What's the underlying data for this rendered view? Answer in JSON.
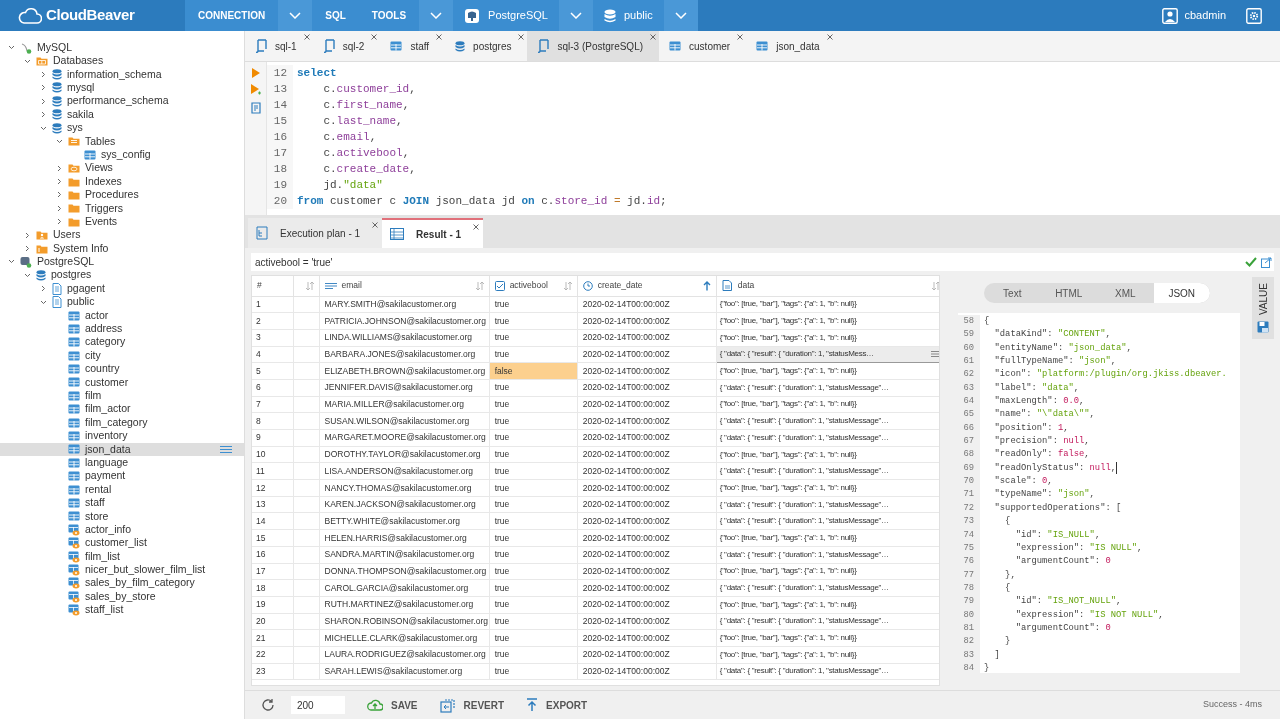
{
  "app": {
    "logo": "CloudBeaver",
    "menu": [
      {
        "kind": "text",
        "label": "CONNECTION"
      },
      {
        "kind": "dropdown"
      },
      {
        "kind": "text",
        "label": "SQL"
      },
      {
        "kind": "text",
        "label": "TOOLS"
      },
      {
        "kind": "dropdown"
      },
      {
        "kind": "connection",
        "label": "PostgreSQL"
      },
      {
        "kind": "dropdown"
      },
      {
        "kind": "schema",
        "label": "public"
      },
      {
        "kind": "dropdown"
      }
    ],
    "user": "cbadmin"
  },
  "tree": [
    {
      "label": "MySQL",
      "kind": "mysql",
      "expanded": true,
      "selected": false,
      "children": [
        {
          "label": "Databases",
          "kind": "db-folder",
          "expanded": true,
          "selected": false,
          "children": [
            {
              "label": "information_schema",
              "kind": "database",
              "expanded": false,
              "selected": false
            },
            {
              "label": "mysql",
              "kind": "database",
              "expanded": false,
              "selected": false
            },
            {
              "label": "performance_schema",
              "kind": "database",
              "expanded": false,
              "selected": false
            },
            {
              "label": "sakila",
              "kind": "database",
              "expanded": false,
              "selected": false
            },
            {
              "label": "sys",
              "kind": "database",
              "expanded": true,
              "selected": false,
              "children": [
                {
                  "label": "Tables",
                  "kind": "tables-folder",
                  "expanded": true,
                  "selected": false,
                  "children": [
                    {
                      "label": "sys_config",
                      "kind": "table",
                      "selected": false
                    }
                  ]
                },
                {
                  "label": "Views",
                  "kind": "views-folder",
                  "expanded": false,
                  "selected": false
                },
                {
                  "label": "Indexes",
                  "kind": "folder",
                  "expanded": false,
                  "selected": false
                },
                {
                  "label": "Procedures",
                  "kind": "folder",
                  "expanded": false,
                  "selected": false
                },
                {
                  "label": "Triggers",
                  "kind": "folder",
                  "expanded": false,
                  "selected": false
                },
                {
                  "label": "Events",
                  "kind": "folder",
                  "expanded": false,
                  "selected": false
                }
              ]
            }
          ]
        },
        {
          "label": "Users",
          "kind": "users-folder",
          "expanded": false,
          "selected": false
        },
        {
          "label": "System Info",
          "kind": "info-folder",
          "expanded": false,
          "selected": false
        }
      ]
    },
    {
      "label": "PostgreSQL",
      "kind": "postgres",
      "expanded": true,
      "selected": false,
      "children": [
        {
          "label": "postgres",
          "kind": "database",
          "expanded": true,
          "selected": false,
          "children": [
            {
              "label": "pgagent",
              "kind": "schema",
              "expanded": false,
              "selected": false
            },
            {
              "label": "public",
              "kind": "schema",
              "expanded": true,
              "selected": false,
              "children": [
                {
                  "label": "actor",
                  "kind": "table",
                  "selected": false
                },
                {
                  "label": "address",
                  "kind": "table",
                  "selected": false
                },
                {
                  "label": "category",
                  "kind": "table",
                  "selected": false
                },
                {
                  "label": "city",
                  "kind": "table",
                  "selected": false
                },
                {
                  "label": "country",
                  "kind": "table",
                  "selected": false
                },
                {
                  "label": "customer",
                  "kind": "table",
                  "selected": false
                },
                {
                  "label": "film",
                  "kind": "table",
                  "selected": false
                },
                {
                  "label": "film_actor",
                  "kind": "table",
                  "selected": false
                },
                {
                  "label": "film_category",
                  "kind": "table",
                  "selected": false
                },
                {
                  "label": "inventory",
                  "kind": "table",
                  "selected": false
                },
                {
                  "label": "json_data",
                  "kind": "table",
                  "selected": true
                },
                {
                  "label": "language",
                  "kind": "table",
                  "selected": false
                },
                {
                  "label": "payment",
                  "kind": "table",
                  "selected": false
                },
                {
                  "label": "rental",
                  "kind": "table",
                  "selected": false
                },
                {
                  "label": "staff",
                  "kind": "table",
                  "selected": false
                },
                {
                  "label": "store",
                  "kind": "table",
                  "selected": false
                },
                {
                  "label": "actor_info",
                  "kind": "view",
                  "selected": false
                },
                {
                  "label": "customer_list",
                  "kind": "view",
                  "selected": false
                },
                {
                  "label": "film_list",
                  "kind": "view",
                  "selected": false
                },
                {
                  "label": "nicer_but_slower_film_list",
                  "kind": "view",
                  "selected": false
                },
                {
                  "label": "sales_by_film_category",
                  "kind": "view",
                  "selected": false
                },
                {
                  "label": "sales_by_store",
                  "kind": "view",
                  "selected": false
                },
                {
                  "label": "staff_list",
                  "kind": "view",
                  "selected": false
                }
              ]
            }
          ]
        }
      ]
    }
  ],
  "editor_tabs": [
    {
      "label": "sql-1",
      "kind": "script",
      "selected": false
    },
    {
      "label": "sql-2",
      "kind": "script",
      "selected": false
    },
    {
      "label": "staff",
      "kind": "table",
      "selected": false
    },
    {
      "label": "postgres",
      "kind": "database",
      "selected": false
    },
    {
      "label": "sql-3 (PostgreSQL)",
      "kind": "script",
      "selected": true
    },
    {
      "label": "customer",
      "kind": "table",
      "selected": false
    },
    {
      "label": "json_data",
      "kind": "table",
      "selected": false
    }
  ],
  "code_lines": [
    {
      "number": "12",
      "tokens": [
        {
          "kind": "keyword",
          "t": "select"
        }
      ]
    },
    {
      "number": "13",
      "tokens": [
        {
          "kind": "plain",
          "t": "    c."
        },
        {
          "kind": "ident",
          "t": "customer_id"
        },
        {
          "kind": "plain",
          "t": ","
        }
      ]
    },
    {
      "number": "14",
      "tokens": [
        {
          "kind": "plain",
          "t": "    c."
        },
        {
          "kind": "ident",
          "t": "first_name"
        },
        {
          "kind": "plain",
          "t": ","
        }
      ]
    },
    {
      "number": "15",
      "tokens": [
        {
          "kind": "plain",
          "t": "    c."
        },
        {
          "kind": "ident",
          "t": "last_name"
        },
        {
          "kind": "plain",
          "t": ","
        }
      ]
    },
    {
      "number": "16",
      "tokens": [
        {
          "kind": "plain",
          "t": "    c."
        },
        {
          "kind": "ident",
          "t": "email"
        },
        {
          "kind": "plain",
          "t": ","
        }
      ]
    },
    {
      "number": "17",
      "tokens": [
        {
          "kind": "plain",
          "t": "    c."
        },
        {
          "kind": "ident",
          "t": "activebool"
        },
        {
          "kind": "plain",
          "t": ","
        }
      ]
    },
    {
      "number": "18",
      "tokens": [
        {
          "kind": "plain",
          "t": "    c."
        },
        {
          "kind": "ident",
          "t": "create_date"
        },
        {
          "kind": "plain",
          "t": ","
        }
      ]
    },
    {
      "number": "19",
      "tokens": [
        {
          "kind": "plain",
          "t": "    jd."
        },
        {
          "kind": "string",
          "t": "\"data\""
        }
      ]
    },
    {
      "number": "20",
      "tokens": [
        {
          "kind": "keyword",
          "t": "from"
        },
        {
          "kind": "plain",
          "t": " customer c "
        },
        {
          "kind": "keyword",
          "t": "JOIN"
        },
        {
          "kind": "plain",
          "t": " json_data jd "
        },
        {
          "kind": "keyword",
          "t": "on"
        },
        {
          "kind": "plain",
          "t": " c."
        },
        {
          "kind": "ident",
          "t": "store_id"
        },
        {
          "kind": "operator",
          "t": " = "
        },
        {
          "kind": "plain",
          "t": "jd."
        },
        {
          "kind": "ident",
          "t": "id"
        },
        {
          "kind": "plain",
          "t": ";"
        }
      ]
    }
  ],
  "result_tabs": [
    {
      "label": "Execution plan - 1",
      "kind": "plan",
      "selected": false
    },
    {
      "label": "Result - 1",
      "kind": "grid",
      "selected": true
    }
  ],
  "filter": "activebool = 'true'",
  "columns": [
    {
      "label": "#",
      "kind": "index",
      "sortable": false,
      "sorted": false
    },
    {
      "kind": "blank",
      "sortable": true,
      "sorted": false
    },
    {
      "label": "email",
      "kind": "text",
      "sortable": true,
      "sorted": false
    },
    {
      "label": "activebool",
      "kind": "boolean",
      "sortable": true,
      "sorted": false
    },
    {
      "label": "create_date",
      "kind": "date",
      "sortable": true,
      "sorted": true
    },
    {
      "label": "data",
      "kind": "json",
      "sortable": true,
      "sorted": false
    }
  ],
  "rows": [
    {
      "n": "1",
      "email": "MARY.SMITH@sakilacustomer.org",
      "activebool": "true",
      "date": "2020-02-14T00:00:00Z",
      "data": "{\"foo\": [true, \"bar\"], \"tags\": {\"a\": 1, \"b\": null}}",
      "edited": false,
      "data_selected": false
    },
    {
      "n": "2",
      "email": "PATRICIA.JOHNSON@sakilacustomer.org",
      "activebool": "true",
      "date": "2020-02-14T00:00:00Z",
      "data": "{\"foo\": [true, \"bar\"], \"tags\": {\"a\": 1, \"b\": null}}",
      "edited": false,
      "data_selected": false
    },
    {
      "n": "3",
      "email": "LINDA.WILLIAMS@sakilacustomer.org",
      "activebool": "true",
      "date": "2020-02-14T00:00:00Z",
      "data": "{\"foo\": [true, \"bar\"], \"tags\": {\"a\": 1, \"b\": null}}",
      "edited": false,
      "data_selected": false
    },
    {
      "n": "4",
      "email": "BARBARA.JONES@sakilacustomer.org",
      "activebool": "true",
      "date": "2020-02-14T00:00:00Z",
      "data": "{ \"data\": { \"result\": { \"duration\": 1, \"statusMess…",
      "edited": false,
      "data_selected": true
    },
    {
      "n": "5",
      "email": "ELIZABETH.BROWN@sakilacustomer.org",
      "activebool": "false",
      "date": "2020-02-14T00:00:00Z",
      "data": "{\"foo\": [true, \"bar\"], \"tags\": {\"a\": 1, \"b\": null}}",
      "edited": true,
      "data_selected": false
    },
    {
      "n": "6",
      "email": "JENNIFER.DAVIS@sakilacustomer.org",
      "activebool": "true",
      "date": "2020-02-14T00:00:00Z",
      "data": "{ \"data\": { \"result\": { \"duration\": 1, \"statusMessage\"…",
      "edited": false,
      "data_selected": false
    },
    {
      "n": "7",
      "email": "MARIA.MILLER@sakilacustomer.org",
      "activebool": "true",
      "date": "2020-02-14T00:00:00Z",
      "data": "{\"foo\": [true, \"bar\"], \"tags\": {\"a\": 1, \"b\": null}}",
      "edited": false,
      "data_selected": false
    },
    {
      "n": "8",
      "email": "SUSAN.WILSON@sakilacustomer.org",
      "activebool": "true",
      "date": "2020-02-14T00:00:00Z",
      "data": "{ \"data\": { \"result\": { \"duration\": 1, \"statusMessage\"…",
      "edited": false,
      "data_selected": false
    },
    {
      "n": "9",
      "email": "MARGARET.MOORE@sakilacustomer.org",
      "activebool": "true",
      "date": "2020-02-14T00:00:00Z",
      "data": "{ \"data\": { \"result\": { \"duration\": 1, \"statusMessage\"…",
      "edited": false,
      "data_selected": false
    },
    {
      "n": "10",
      "email": "DOROTHY.TAYLOR@sakilacustomer.org",
      "activebool": "true",
      "date": "2020-02-14T00:00:00Z",
      "data": "{\"foo\": [true, \"bar\"], \"tags\": {\"a\": 1, \"b\": null}}",
      "edited": false,
      "data_selected": false
    },
    {
      "n": "11",
      "email": "LISA.ANDERSON@sakilacustomer.org",
      "activebool": "true",
      "date": "2020-02-14T00:00:00Z",
      "data": "{ \"data\": { \"result\": { \"duration\": 1, \"statusMessage\"…",
      "edited": false,
      "data_selected": false
    },
    {
      "n": "12",
      "email": "NANCY.THOMAS@sakilacustomer.org",
      "activebool": "true",
      "date": "2020-02-14T00:00:00Z",
      "data": "{\"foo\": [true, \"bar\"], \"tags\": {\"a\": 1, \"b\": null}}",
      "edited": false,
      "data_selected": false
    },
    {
      "n": "13",
      "email": "KAREN.JACKSON@sakilacustomer.org",
      "activebool": "true",
      "date": "2020-02-14T00:00:00Z",
      "data": "{ \"data\": { \"result\": { \"duration\": 1, \"statusMessage\"…",
      "edited": false,
      "data_selected": false
    },
    {
      "n": "14",
      "email": "BETTY.WHITE@sakilacustomer.org",
      "activebool": "true",
      "date": "2020-02-14T00:00:00Z",
      "data": "{ \"data\": { \"result\": { \"duration\": 1, \"statusMessage\"…",
      "edited": false,
      "data_selected": false
    },
    {
      "n": "15",
      "email": "HELEN.HARRIS@sakilacustomer.org",
      "activebool": "true",
      "date": "2020-02-14T00:00:00Z",
      "data": "{\"foo\": [true, \"bar\"], \"tags\": {\"a\": 1, \"b\": null}}",
      "edited": false,
      "data_selected": false
    },
    {
      "n": "16",
      "email": "SANDRA.MARTIN@sakilacustomer.org",
      "activebool": "true",
      "date": "2020-02-14T00:00:00Z",
      "data": "{ \"data\": { \"result\": { \"duration\": 1, \"statusMessage\"…",
      "edited": false,
      "data_selected": false
    },
    {
      "n": "17",
      "email": "DONNA.THOMPSON@sakilacustomer.org",
      "activebool": "true",
      "date": "2020-02-14T00:00:00Z",
      "data": "{\"foo\": [true, \"bar\"], \"tags\": {\"a\": 1, \"b\": null}}",
      "edited": false,
      "data_selected": false
    },
    {
      "n": "18",
      "email": "CAROL.GARCIA@sakilacustomer.org",
      "activebool": "true",
      "date": "2020-02-14T00:00:00Z",
      "data": "{ \"data\": { \"result\": { \"duration\": 1, \"statusMessage\"…",
      "edited": false,
      "data_selected": false
    },
    {
      "n": "19",
      "email": "RUTH.MARTINEZ@sakilacustomer.org",
      "activebool": "true",
      "date": "2020-02-14T00:00:00Z",
      "data": "{\"foo\": [true, \"bar\"], \"tags\": {\"a\": 1, \"b\": null}}",
      "edited": false,
      "data_selected": false
    },
    {
      "n": "20",
      "email": "SHARON.ROBINSON@sakilacustomer.org",
      "activebool": "true",
      "date": "2020-02-14T00:00:00Z",
      "data": "{ \"data\": { \"result\": { \"duration\": 1, \"statusMessage\"…",
      "edited": false,
      "data_selected": false
    },
    {
      "n": "21",
      "email": "MICHELLE.CLARK@sakilacustomer.org",
      "activebool": "true",
      "date": "2020-02-14T00:00:00Z",
      "data": "{\"foo\": [true, \"bar\"], \"tags\": {\"a\": 1, \"b\": null}}",
      "edited": false,
      "data_selected": false
    },
    {
      "n": "22",
      "email": "LAURA.RODRIGUEZ@sakilacustomer.org",
      "activebool": "true",
      "date": "2020-02-14T00:00:00Z",
      "data": "{\"foo\": [true, \"bar\"], \"tags\": {\"a\": 1, \"b\": null}}",
      "edited": false,
      "data_selected": false
    },
    {
      "n": "23",
      "email": "SARAH.LEWIS@sakilacustomer.org",
      "activebool": "true",
      "date": "2020-02-14T00:00:00Z",
      "data": "{ \"data\": { \"result\": { \"duration\": 1, \"statusMessage\"…",
      "edited": false,
      "data_selected": false
    }
  ],
  "value_panel": {
    "tabs": [
      {
        "label": "Text",
        "selected": false
      },
      {
        "label": "HTML",
        "selected": false
      },
      {
        "label": "XML",
        "selected": false
      },
      {
        "label": "JSON",
        "selected": true
      }
    ],
    "side_tab": "VALUE",
    "lines": [
      {
        "number": "58",
        "tokens": [
          {
            "kind": "plain",
            "t": "{"
          }
        ]
      },
      {
        "number": "59",
        "tokens": [
          {
            "kind": "plain",
            "t": "  \"dataKind\": "
          },
          {
            "kind": "string",
            "t": "\"CONTENT\""
          },
          {
            "kind": "plain",
            "t": ","
          }
        ]
      },
      {
        "number": "60",
        "tokens": [
          {
            "kind": "plain",
            "t": "  \"entityName\": "
          },
          {
            "kind": "string",
            "t": "\"json_data\""
          },
          {
            "kind": "plain",
            "t": ","
          }
        ]
      },
      {
        "number": "61",
        "tokens": [
          {
            "kind": "plain",
            "t": "  \"fullTypeName\": "
          },
          {
            "kind": "string",
            "t": "\"json\""
          },
          {
            "kind": "plain",
            "t": ","
          }
        ]
      },
      {
        "number": "62",
        "tokens": [
          {
            "kind": "plain",
            "t": "  \"icon\": "
          },
          {
            "kind": "string",
            "t": "\"platform:/plugin/org.jkiss.dbeaver."
          }
        ]
      },
      {
        "number": "63",
        "tokens": [
          {
            "kind": "plain",
            "t": "  \"label\": "
          },
          {
            "kind": "string",
            "t": "\"data\""
          },
          {
            "kind": "plain",
            "t": ","
          }
        ]
      },
      {
        "number": "64",
        "tokens": [
          {
            "kind": "plain",
            "t": "  \"maxLength\": "
          },
          {
            "kind": "literal",
            "t": "0.0"
          },
          {
            "kind": "plain",
            "t": ","
          }
        ]
      },
      {
        "number": "65",
        "tokens": [
          {
            "kind": "plain",
            "t": "  \"name\": "
          },
          {
            "kind": "string",
            "t": "\"\\\"data\\\"\""
          },
          {
            "kind": "plain",
            "t": ","
          }
        ]
      },
      {
        "number": "66",
        "tokens": [
          {
            "kind": "plain",
            "t": "  \"position\": "
          },
          {
            "kind": "literal",
            "t": "1"
          },
          {
            "kind": "plain",
            "t": ","
          }
        ]
      },
      {
        "number": "67",
        "tokens": [
          {
            "kind": "plain",
            "t": "  \"precision\": "
          },
          {
            "kind": "literal",
            "t": "null"
          },
          {
            "kind": "plain",
            "t": ","
          }
        ]
      },
      {
        "number": "68",
        "tokens": [
          {
            "kind": "plain",
            "t": "  \"readOnly\": "
          },
          {
            "kind": "literal",
            "t": "false"
          },
          {
            "kind": "plain",
            "t": ","
          }
        ]
      },
      {
        "number": "69",
        "tokens": [
          {
            "kind": "plain",
            "t": "  \"readOnlyStatus\": "
          },
          {
            "kind": "literal",
            "t": "null"
          },
          {
            "kind": "plain",
            "t": ","
          }
        ],
        "caret": true
      },
      {
        "number": "70",
        "tokens": [
          {
            "kind": "plain",
            "t": "  \"scale\": "
          },
          {
            "kind": "literal",
            "t": "0"
          },
          {
            "kind": "plain",
            "t": ","
          }
        ]
      },
      {
        "number": "71",
        "tokens": [
          {
            "kind": "plain",
            "t": "  \"typeName\": "
          },
          {
            "kind": "string",
            "t": "\"json\""
          },
          {
            "kind": "plain",
            "t": ","
          }
        ]
      },
      {
        "number": "72",
        "tokens": [
          {
            "kind": "plain",
            "t": "  \"supportedOperations\": ["
          }
        ]
      },
      {
        "number": "73",
        "tokens": [
          {
            "kind": "plain",
            "t": "    {"
          }
        ]
      },
      {
        "number": "74",
        "tokens": [
          {
            "kind": "plain",
            "t": "      \"id\": "
          },
          {
            "kind": "string",
            "t": "\"IS_NULL\""
          },
          {
            "kind": "plain",
            "t": ","
          }
        ]
      },
      {
        "number": "75",
        "tokens": [
          {
            "kind": "plain",
            "t": "      \"expression\": "
          },
          {
            "kind": "string",
            "t": "\"IS NULL\""
          },
          {
            "kind": "plain",
            "t": ","
          }
        ]
      },
      {
        "number": "76",
        "tokens": [
          {
            "kind": "plain",
            "t": "      \"argumentCount\": "
          },
          {
            "kind": "literal",
            "t": "0"
          }
        ]
      },
      {
        "number": "77",
        "tokens": [
          {
            "kind": "plain",
            "t": "    },"
          }
        ]
      },
      {
        "number": "78",
        "tokens": [
          {
            "kind": "plain",
            "t": "    {"
          }
        ]
      },
      {
        "number": "79",
        "tokens": [
          {
            "kind": "plain",
            "t": "      \"id\": "
          },
          {
            "kind": "string",
            "t": "\"IS_NOT_NULL\""
          },
          {
            "kind": "plain",
            "t": ","
          }
        ]
      },
      {
        "number": "80",
        "tokens": [
          {
            "kind": "plain",
            "t": "      \"expression\": "
          },
          {
            "kind": "string",
            "t": "\"IS NOT NULL\""
          },
          {
            "kind": "plain",
            "t": ","
          }
        ]
      },
      {
        "number": "81",
        "tokens": [
          {
            "kind": "plain",
            "t": "      \"argumentCount\": "
          },
          {
            "kind": "literal",
            "t": "0"
          }
        ]
      },
      {
        "number": "82",
        "tokens": [
          {
            "kind": "plain",
            "t": "    }"
          }
        ]
      },
      {
        "number": "83",
        "tokens": [
          {
            "kind": "plain",
            "t": "  ]"
          }
        ]
      },
      {
        "number": "84",
        "tokens": [
          {
            "kind": "plain",
            "t": "}"
          }
        ]
      }
    ]
  },
  "footer": {
    "fetch_size": "200",
    "buttons": [
      {
        "label": "SAVE",
        "kind": "upload"
      },
      {
        "label": "REVERT",
        "kind": "revert"
      },
      {
        "label": "EXPORT",
        "kind": "export"
      }
    ],
    "status": "Success - 4ms"
  }
}
